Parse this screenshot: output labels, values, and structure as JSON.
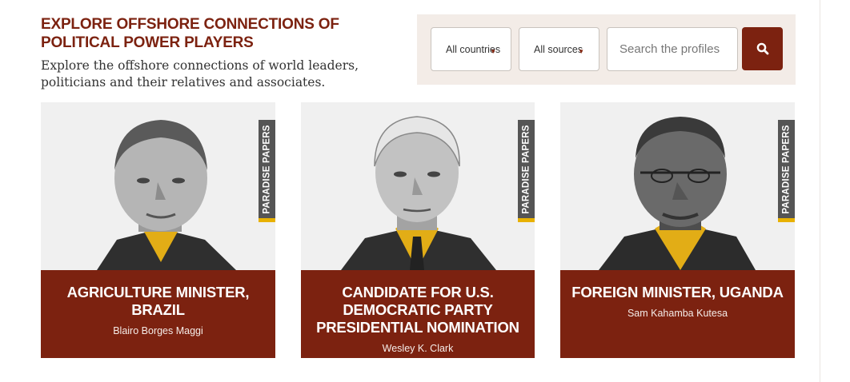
{
  "header": {
    "title": "EXPLORE OFFSHORE CONNECTIONS OF POLITICAL POWER PLAYERS",
    "subtitle": "Explore the offshore connections of world leaders, politicians and their relatives and associates."
  },
  "filters": {
    "countries": {
      "selected": "All countries",
      "icon": "chevron-down-icon"
    },
    "sources": {
      "selected": "All sources",
      "icon": "chevron-down-icon"
    },
    "search": {
      "placeholder": "Search the profiles",
      "value": ""
    },
    "search_button": {
      "icon": "search-icon"
    }
  },
  "colors": {
    "accent": "#7c2210",
    "panel_bg": "#f3ece7",
    "tag_bg": "#555555",
    "tag_stripe": "#e8b100",
    "card_bg": "#f0f0f0"
  },
  "profiles": [
    {
      "role": "AGRICULTURE MINISTER, BRAZIL",
      "name": "Blairo Borges Maggi",
      "tag": "PARADISE PAPERS"
    },
    {
      "role": "CANDIDATE FOR U.S. DEMOCRATIC PARTY PRESIDENTIAL NOMINATION",
      "name": "Wesley K. Clark",
      "tag": "PARADISE PAPERS"
    },
    {
      "role": "FOREIGN MINISTER, UGANDA",
      "name": "Sam Kahamba Kutesa",
      "tag": "PARADISE PAPERS"
    }
  ]
}
